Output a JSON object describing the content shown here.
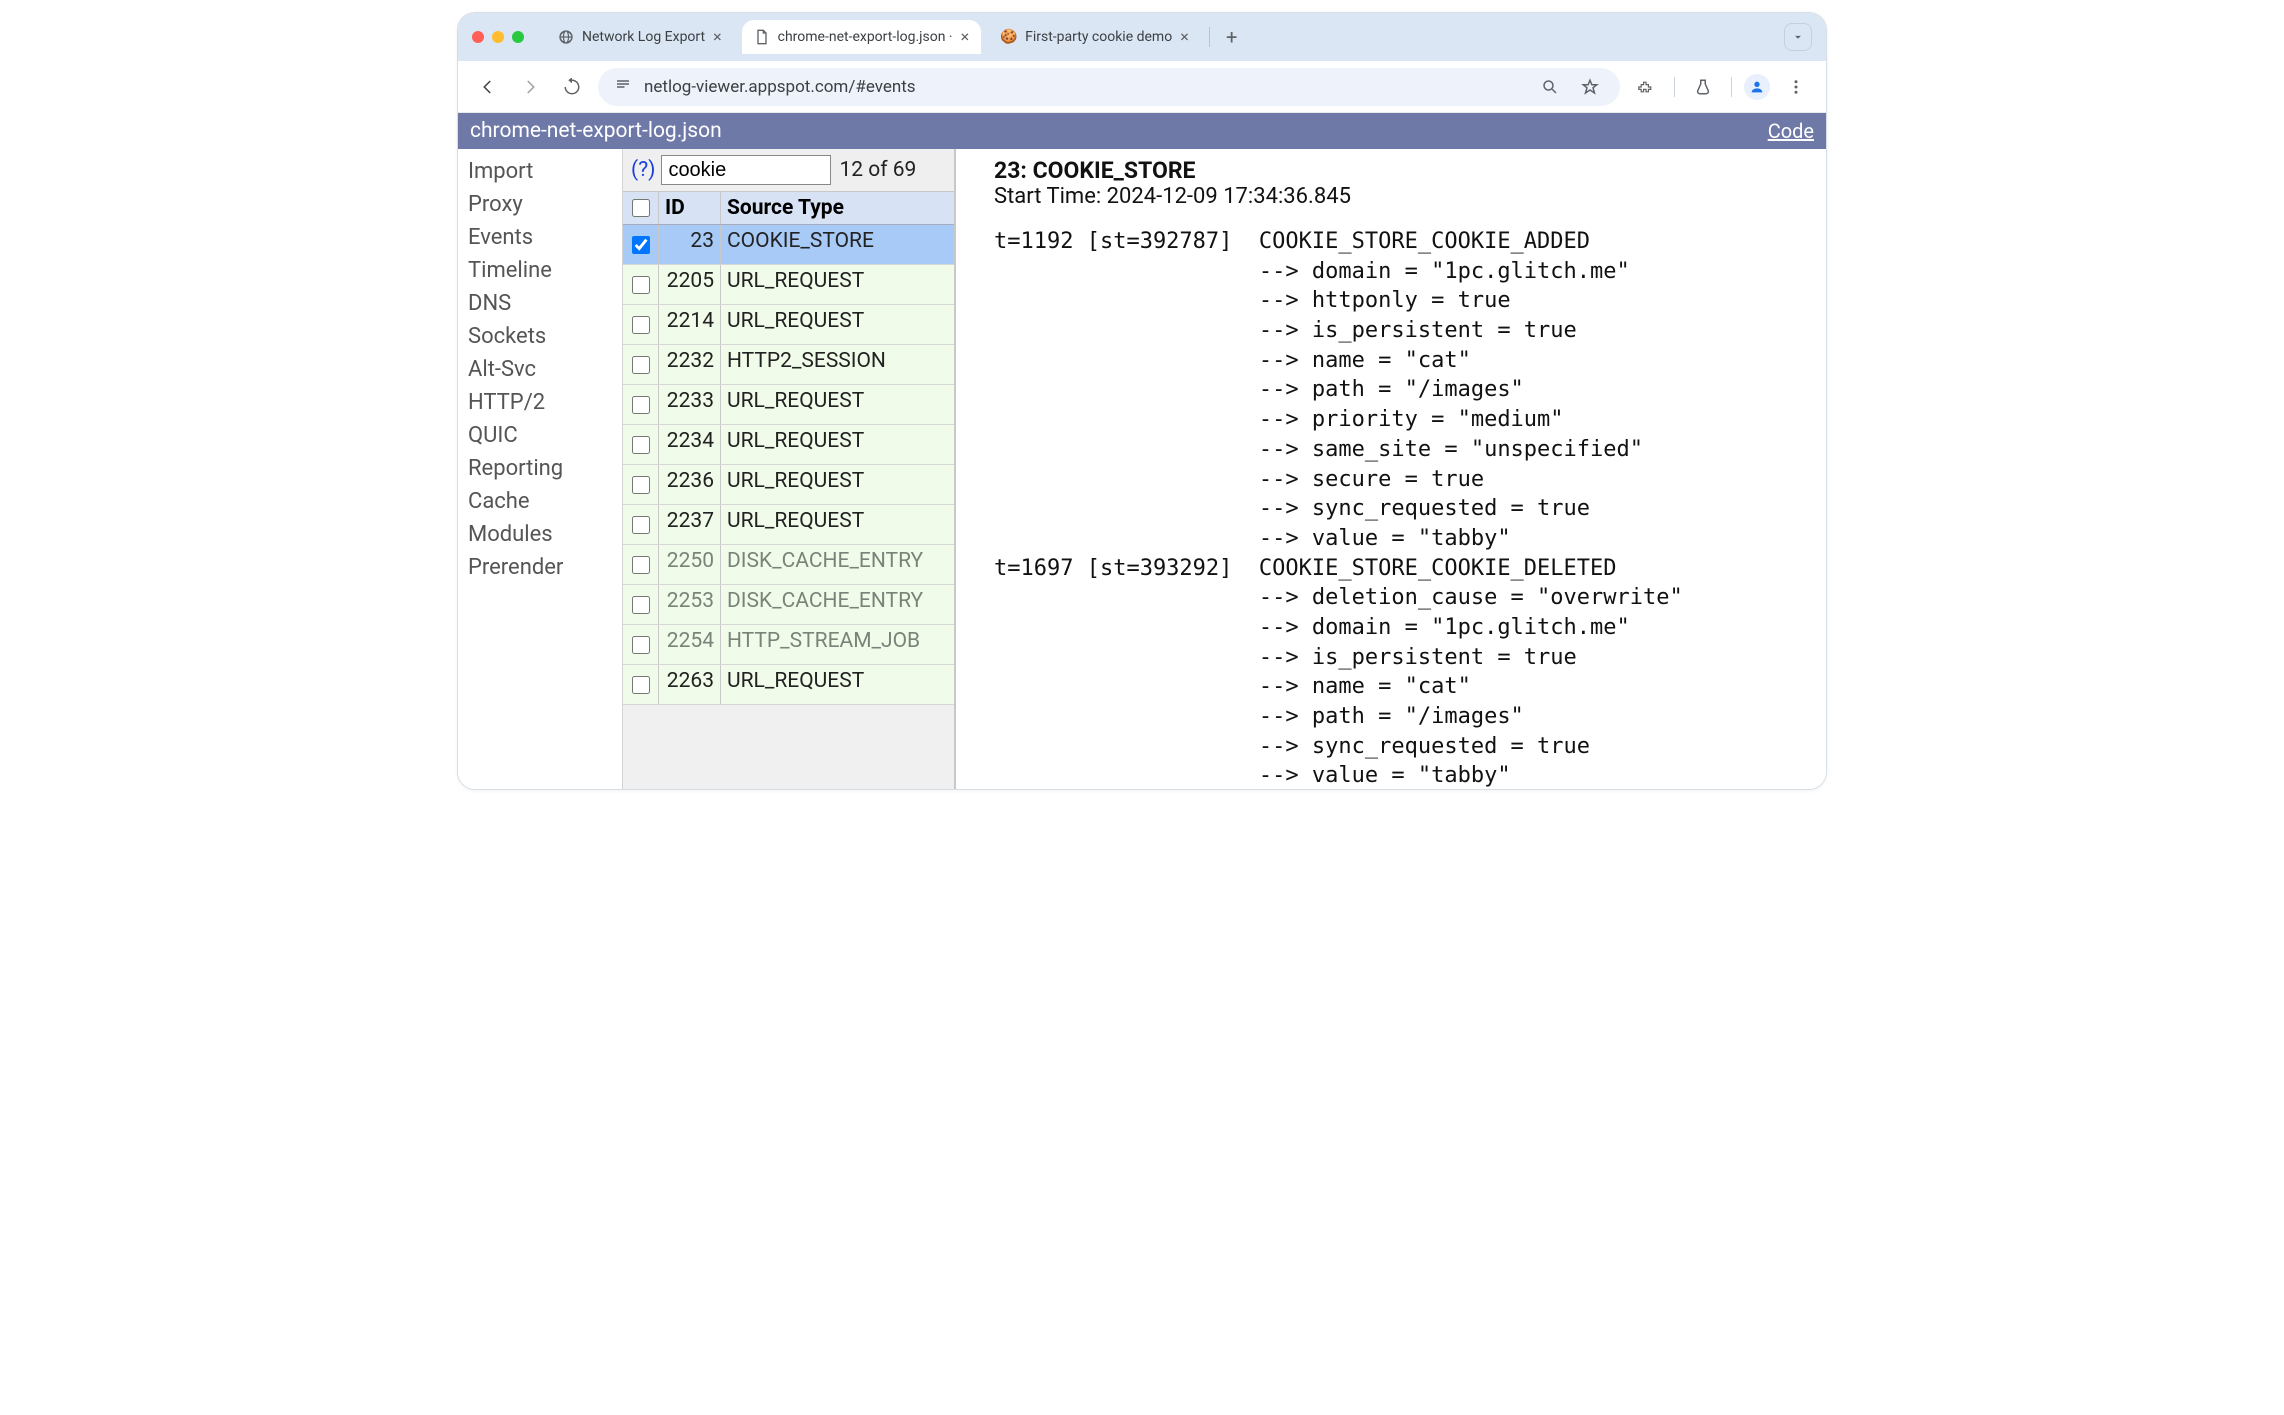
{
  "browser": {
    "tabs": [
      {
        "title": "Network Log Export",
        "icon": "globe",
        "active": false
      },
      {
        "title": "chrome-net-export-log.json · ",
        "icon": "file",
        "active": true
      },
      {
        "title": "First-party cookie demo",
        "icon": "cookie",
        "active": false
      }
    ],
    "url": "netlog-viewer.appspot.com/#events"
  },
  "appbar": {
    "title": "chrome-net-export-log.json",
    "code": "Code"
  },
  "sidenav": [
    "Import",
    "Proxy",
    "Events",
    "Timeline",
    "DNS",
    "Sockets",
    "Alt-Svc",
    "HTTP/2",
    "QUIC",
    "Reporting",
    "Cache",
    "Modules",
    "Prerender"
  ],
  "filter": {
    "help": "(?)",
    "value": "cookie",
    "count": "12 of 69",
    "header_id": "ID",
    "header_type": "Source Type"
  },
  "events": [
    {
      "id": "23",
      "type": "COOKIE_STORE",
      "selected": true,
      "inactive": false
    },
    {
      "id": "2205",
      "type": "URL_REQUEST",
      "selected": false,
      "inactive": false
    },
    {
      "id": "2214",
      "type": "URL_REQUEST",
      "selected": false,
      "inactive": false
    },
    {
      "id": "2232",
      "type": "HTTP2_SESSION",
      "selected": false,
      "inactive": false
    },
    {
      "id": "2233",
      "type": "URL_REQUEST",
      "selected": false,
      "inactive": false
    },
    {
      "id": "2234",
      "type": "URL_REQUEST",
      "selected": false,
      "inactive": false
    },
    {
      "id": "2236",
      "type": "URL_REQUEST",
      "selected": false,
      "inactive": false
    },
    {
      "id": "2237",
      "type": "URL_REQUEST",
      "selected": false,
      "inactive": false
    },
    {
      "id": "2250",
      "type": "DISK_CACHE_ENTRY",
      "selected": false,
      "inactive": true
    },
    {
      "id": "2253",
      "type": "DISK_CACHE_ENTRY",
      "selected": false,
      "inactive": true
    },
    {
      "id": "2254",
      "type": "HTTP_STREAM_JOB",
      "selected": false,
      "inactive": true
    },
    {
      "id": "2263",
      "type": "URL_REQUEST",
      "selected": false,
      "inactive": false
    }
  ],
  "details": {
    "header": "23: COOKIE_STORE",
    "start": "Start Time: 2024-12-09 17:34:36.845",
    "log": "t=1192 [st=392787]  COOKIE_STORE_COOKIE_ADDED\n                    --> domain = \"1pc.glitch.me\"\n                    --> httponly = true\n                    --> is_persistent = true\n                    --> name = \"cat\"\n                    --> path = \"/images\"\n                    --> priority = \"medium\"\n                    --> same_site = \"unspecified\"\n                    --> secure = true\n                    --> sync_requested = true\n                    --> value = \"tabby\"\nt=1697 [st=393292]  COOKIE_STORE_COOKIE_DELETED\n                    --> deletion_cause = \"overwrite\"\n                    --> domain = \"1pc.glitch.me\"\n                    --> is_persistent = true\n                    --> name = \"cat\"\n                    --> path = \"/images\"\n                    --> sync_requested = true\n                    --> value = \"tabby\""
  }
}
